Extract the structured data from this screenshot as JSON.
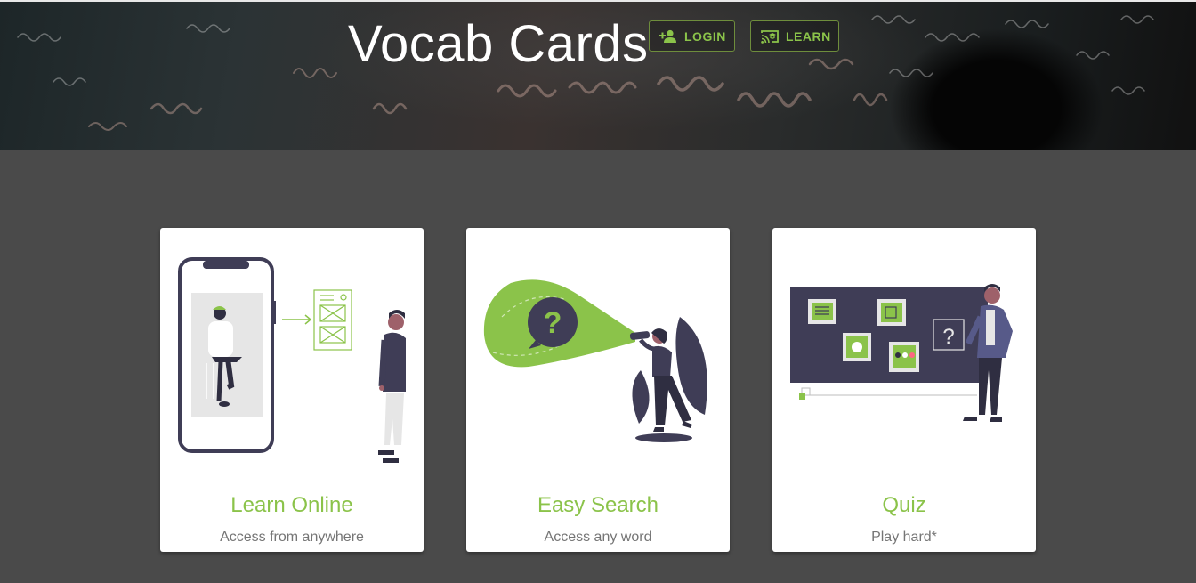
{
  "app": {
    "title": "Vocab Cards"
  },
  "nav": {
    "login_label": "LOGIN",
    "learn_label": "LEARN"
  },
  "cards": [
    {
      "title": "Learn Online",
      "subtitle": "Access from anywhere"
    },
    {
      "title": "Easy Search",
      "subtitle": "Access any word"
    },
    {
      "title": "Quiz",
      "subtitle": "Play hard*"
    }
  ],
  "colors": {
    "accent": "#8bc34a",
    "background": "#4a4a4a",
    "card": "#ffffff",
    "ink": "#3f3d56"
  },
  "icons": {
    "login": "person-add-icon",
    "learn": "cast-for-education-icon"
  }
}
